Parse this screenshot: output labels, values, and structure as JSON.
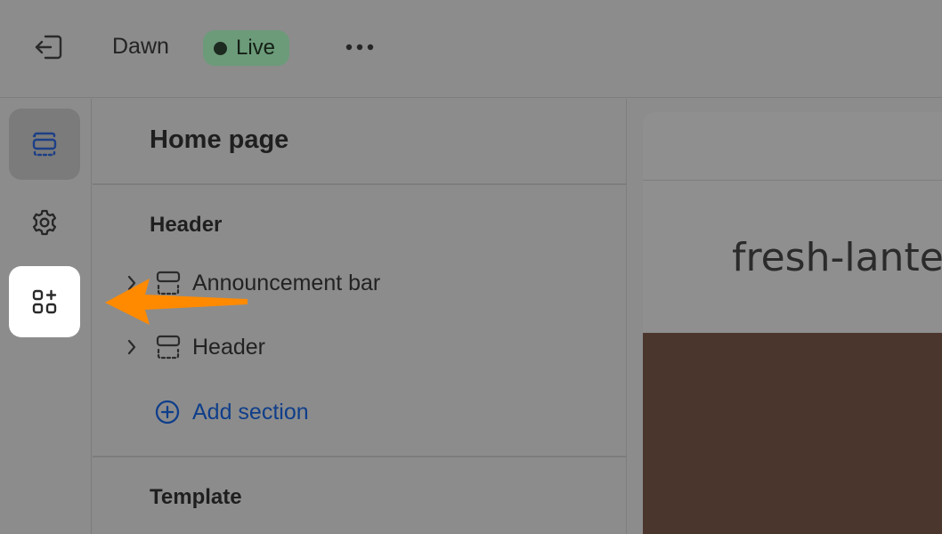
{
  "topbar": {
    "exit_icon": "exit-icon",
    "theme_name": "Dawn",
    "status_label": "Live",
    "more_icon": "more-horizontal-icon"
  },
  "rail": {
    "items": [
      {
        "name": "sections",
        "icon": "sections-layout-icon",
        "active": true
      },
      {
        "name": "theme-settings",
        "icon": "gear-icon",
        "active": false
      },
      {
        "name": "apps",
        "icon": "apps-add-icon",
        "highlighted": true
      }
    ]
  },
  "panel": {
    "title": "Home page",
    "header_group": {
      "title": "Header",
      "items": [
        {
          "label": "Announcement bar",
          "icon": "section-header-icon"
        },
        {
          "label": "Header",
          "icon": "section-header-icon"
        }
      ],
      "add_section_label": "Add section"
    },
    "template_group": {
      "title": "Template"
    }
  },
  "preview": {
    "store_name": "fresh-lanter"
  },
  "colors": {
    "accent_arrow": "#ff8a00",
    "live_badge": "#6c9b7a",
    "link_blue": "#0f3e8a",
    "banner_brown": "#4b362e"
  }
}
